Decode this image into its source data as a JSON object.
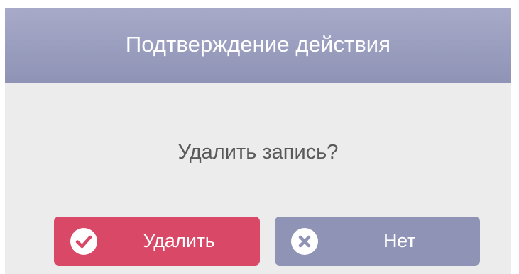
{
  "dialog": {
    "title": "Подтверждение действия",
    "message": "Удалить запись?"
  },
  "buttons": {
    "delete": {
      "label": "Удалить",
      "icon": "check-circle-icon",
      "color": "#d94867"
    },
    "no": {
      "label": "Нет",
      "icon": "close-circle-icon",
      "color": "#8f93b5"
    }
  },
  "colors": {
    "header": "#9a9ebe",
    "body": "#ececec"
  }
}
